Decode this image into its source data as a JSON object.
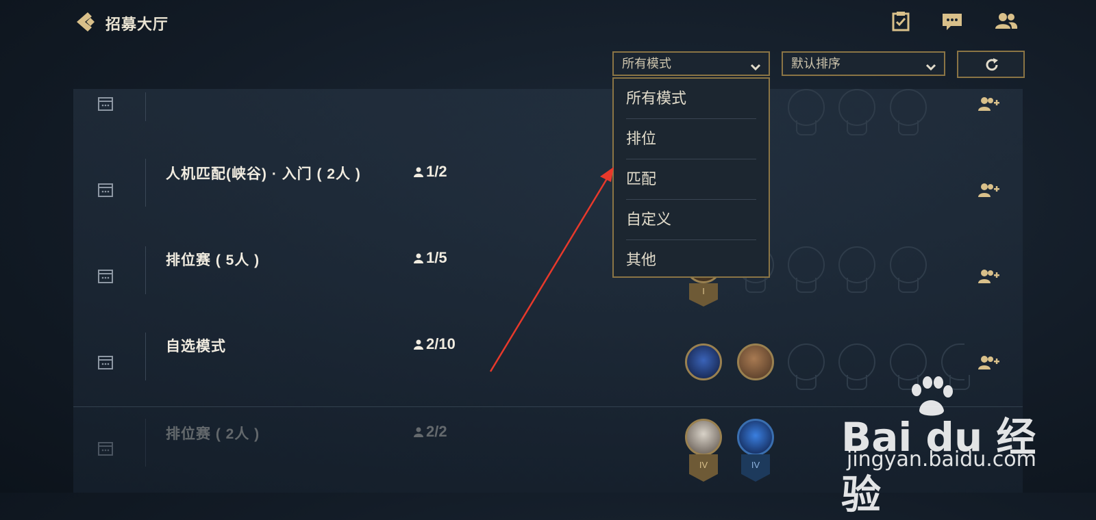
{
  "header": {
    "title": "招募大厅",
    "icons": [
      "back-arrow-icon",
      "tasks-icon",
      "chat-icon",
      "friends-icon"
    ]
  },
  "filters": {
    "mode_selected": "所有模式",
    "sort_selected": "默认排序"
  },
  "dropdown": {
    "options": [
      "所有模式",
      "排位",
      "匹配",
      "自定义",
      "其他"
    ]
  },
  "rows": [
    {
      "name": "",
      "count": ""
    },
    {
      "name": "人机匹配(峡谷) · 入门 ( 2人 )",
      "count": "1/2"
    },
    {
      "name": "排位赛 ( 5人 )",
      "count": "1/5"
    },
    {
      "name": "自选模式",
      "count": "2/10"
    },
    {
      "name": "排位赛 ( 2人 )",
      "count": "2/2"
    }
  ],
  "rank_badges": [
    "I",
    "IV",
    "IV"
  ],
  "watermark": {
    "logo": "Bai du 经验",
    "url": "jingyan.baidu.com"
  },
  "colors": {
    "accent_gold": "#8b7545",
    "icon_gold": "#d9c08a",
    "annotation_red": "#e8392b"
  }
}
